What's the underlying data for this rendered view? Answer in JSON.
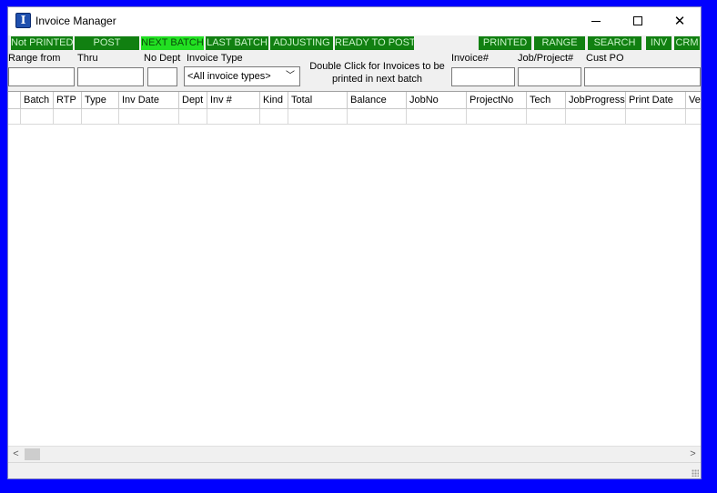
{
  "window": {
    "title": "Invoice Manager"
  },
  "icons": {
    "app": "invoice-manager-app-icon",
    "minimize": "minimize-icon",
    "maximize": "maximize-icon",
    "close": "close-icon",
    "left": "arrow-left-icon",
    "right": "arrow-right-icon"
  },
  "colors": {
    "button_green": "#118011",
    "button_active": "#22e022",
    "background": "#0000ff"
  },
  "toolbar": {
    "buttons": [
      "Not PRINTED",
      "POST",
      "NEXT BATCH",
      "LAST BATCH",
      "ADJUSTING",
      "READY TO POST",
      "PRINTED",
      "RANGE",
      "SEARCH",
      "INV",
      "CRM"
    ],
    "active": "NEXT BATCH"
  },
  "filters": {
    "range_from_label": "Range from",
    "thru_label": "Thru",
    "no_dept_label": "No Dept",
    "invoice_type_label": "Invoice Type",
    "invoice_type_value": "<All invoice types>",
    "hint": "Double Click for Invoices to be printed in next batch",
    "invoice_no_label": "Invoice#",
    "job_project_label": "Job/Project#",
    "cust_po_label": "Cust PO"
  },
  "grid": {
    "columns": [
      "Batch",
      "RTP",
      "Type",
      "Inv Date",
      "Dept",
      "Inv #",
      "Kind",
      "Total",
      "Balance",
      "JobNo",
      "ProjectNo",
      "Tech",
      "JobProgress",
      "Print Date",
      "Ve"
    ]
  },
  "scroll": {
    "left": "<",
    "right": ">"
  }
}
